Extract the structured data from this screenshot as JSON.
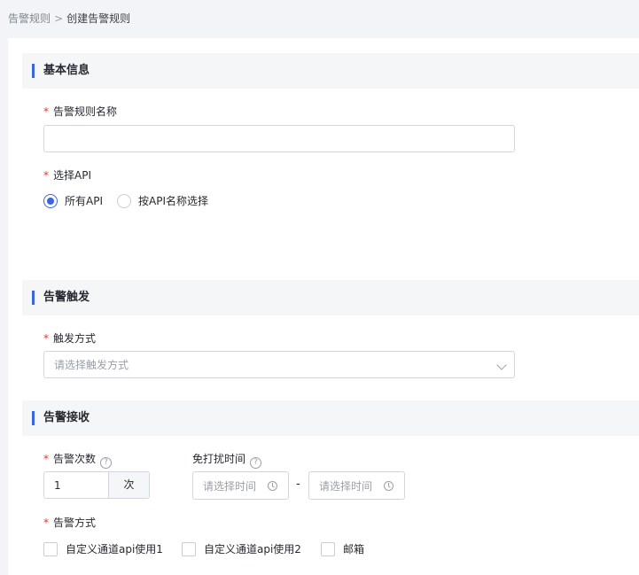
{
  "breadcrumb": {
    "parent": "告警规则",
    "separator": ">",
    "current": "创建告警规则"
  },
  "sections": {
    "basic": {
      "title": "基本信息"
    },
    "trigger": {
      "title": "告警触发"
    },
    "receive": {
      "title": "告警接收"
    }
  },
  "fields": {
    "rule_name": {
      "required_mark": "*",
      "label": "告警规则名称",
      "value": "",
      "placeholder": ""
    },
    "select_api": {
      "required_mark": "*",
      "label": "选择API",
      "options": [
        {
          "label": "所有API",
          "checked": true
        },
        {
          "label": "按API名称选择",
          "checked": false
        }
      ]
    },
    "trigger_mode": {
      "required_mark": "*",
      "label": "触发方式",
      "placeholder": "请选择触发方式"
    },
    "alert_count": {
      "required_mark": "*",
      "label": "告警次数",
      "help": "?",
      "value": "1",
      "unit": "次"
    },
    "quiet_time": {
      "label": "免打扰时间",
      "help": "?",
      "start_placeholder": "请选择时间",
      "separator": "-",
      "end_placeholder": "请选择时间"
    },
    "alert_method": {
      "required_mark": "*",
      "label": "告警方式",
      "options": [
        {
          "label": "自定义通道api使用1",
          "checked": false
        },
        {
          "label": "自定义通道api使用2",
          "checked": false
        },
        {
          "label": "邮箱",
          "checked": false
        }
      ]
    }
  },
  "colors": {
    "accent": "#3d64e0",
    "required": "#e6392f",
    "page_bg": "#f3f4f7",
    "section_bg": "#f5f6f8"
  },
  "icons": {
    "help": "question-circle-icon",
    "dropdown": "chevron-down-icon",
    "time": "clock-icon"
  }
}
